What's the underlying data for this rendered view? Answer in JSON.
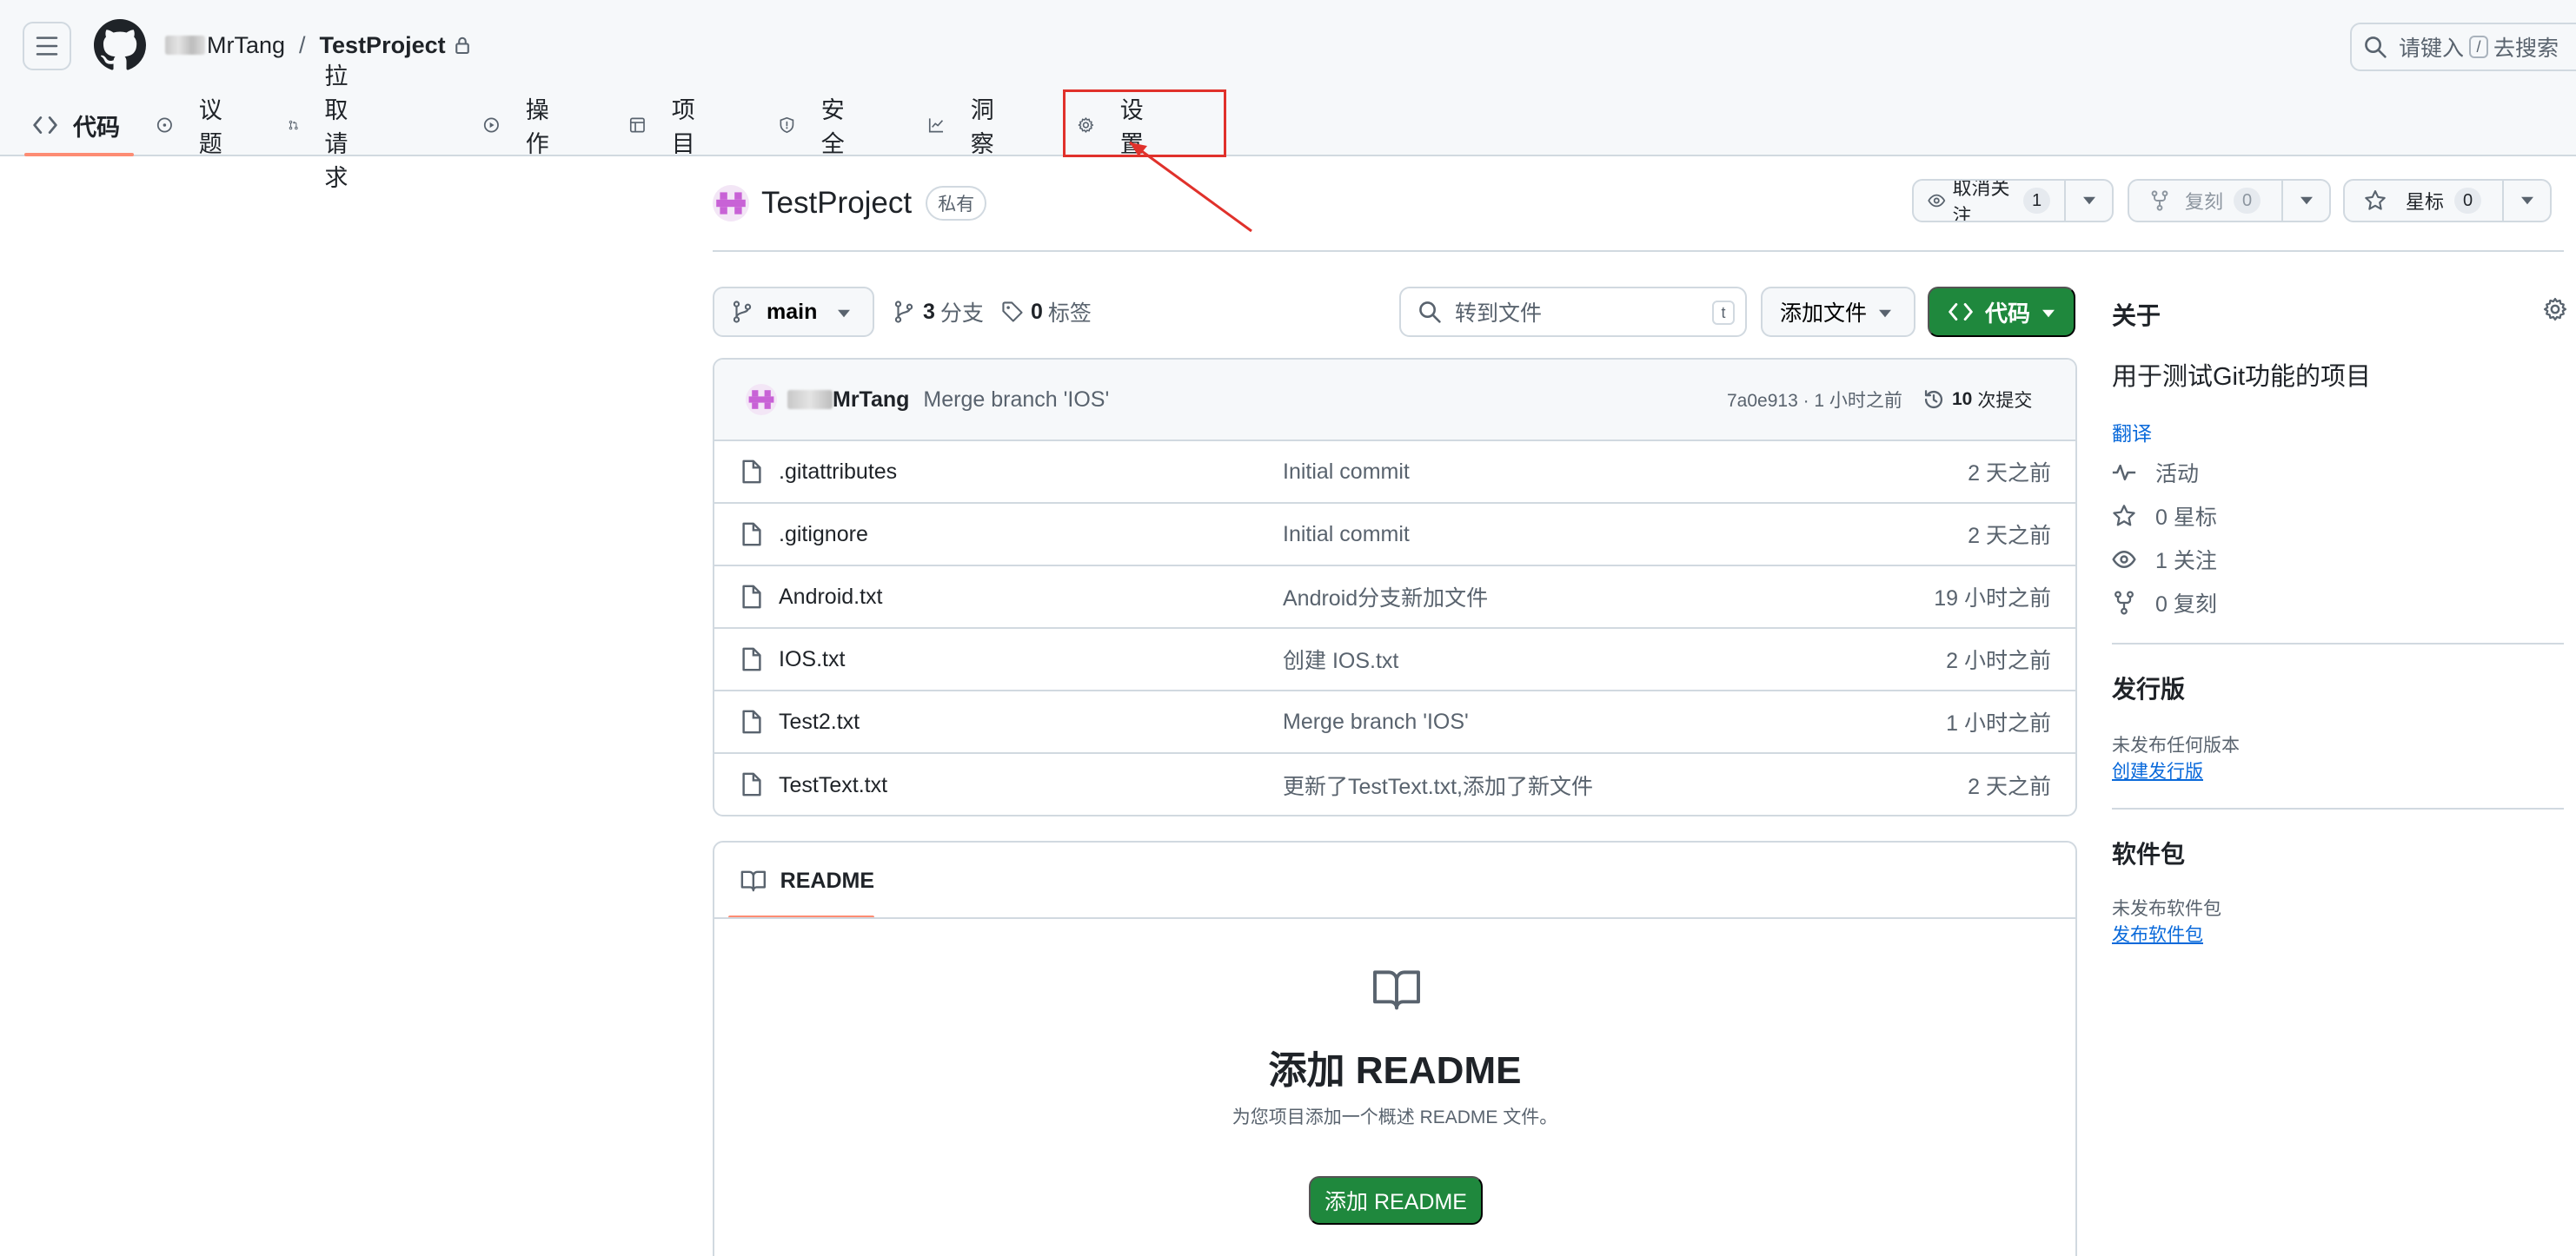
{
  "header": {
    "owner": "MrTang",
    "separator": "/",
    "repo": "TestProject",
    "search_placeholder_pre": "请键入",
    "search_slash": "/",
    "search_placeholder_post": "去搜索"
  },
  "tabs": [
    {
      "label": "代码",
      "icon": "code-icon",
      "active": true
    },
    {
      "label": "议题",
      "icon": "issue-opened-icon"
    },
    {
      "label": "拉取请求",
      "icon": "git-pull-request-icon"
    },
    {
      "label": "操作",
      "icon": "play-icon"
    },
    {
      "label": "项目",
      "icon": "table-icon"
    },
    {
      "label": "安全",
      "icon": "shield-icon"
    },
    {
      "label": "洞察",
      "icon": "graph-icon"
    },
    {
      "label": "设置",
      "icon": "gear-icon",
      "highlighted": true
    }
  ],
  "repo_title": {
    "name": "TestProject",
    "visibility": "私有"
  },
  "actions": {
    "watch_label": "取消关注",
    "watch_count": "1",
    "fork_label": "复刻",
    "fork_count": "0",
    "star_label": "星标",
    "star_count": "0"
  },
  "file_nav": {
    "branch": "main",
    "branches_count": "3",
    "branches_label": "分支",
    "tags_count": "0",
    "tags_label": "标签",
    "goto_placeholder": "转到文件",
    "goto_key": "t",
    "add_file_label": "添加文件",
    "code_label": "代码"
  },
  "latest_commit": {
    "author": "MrTang",
    "message": "Merge branch 'IOS'",
    "sha_and_age": "7a0e913 · 1 小时之前",
    "commits_count": "10",
    "commits_label": "次提交"
  },
  "files": [
    {
      "name": ".gitattributes",
      "message": "Initial commit",
      "age": "2 天之前"
    },
    {
      "name": ".gitignore",
      "message": "Initial commit",
      "age": "2 天之前"
    },
    {
      "name": "Android.txt",
      "message": "Android分支新加文件",
      "age": "19 小时之前"
    },
    {
      "name": "IOS.txt",
      "message": "创建 IOS.txt",
      "age": "2 小时之前"
    },
    {
      "name": "Test2.txt",
      "message": "Merge branch 'IOS'",
      "age": "1 小时之前"
    },
    {
      "name": "TestText.txt",
      "message": "更新了TestText.txt,添加了新文件",
      "age": "2 天之前"
    }
  ],
  "readme": {
    "tab_label": "README",
    "heading": "添加 README",
    "description": "为您项目添加一个概述 README 文件。",
    "button_label": "添加 README"
  },
  "sidebar": {
    "about_heading": "关于",
    "description": "用于测试Git功能的项目",
    "translate_link": "翻译",
    "stats": [
      {
        "label": "活动",
        "icon": "pulse-icon"
      },
      {
        "label": "0 星标",
        "icon": "star-icon"
      },
      {
        "label": "1 关注",
        "icon": "eye-icon"
      },
      {
        "label": "0 复刻",
        "icon": "repo-forked-icon"
      }
    ],
    "releases_heading": "发行版",
    "releases_note": "未发布任何版本",
    "releases_link": "创建发行版",
    "packages_heading": "软件包",
    "packages_note": "未发布软件包",
    "packages_link": "发布软件包"
  },
  "colors": {
    "primary_green": "#1f883d",
    "link_blue": "#0969da",
    "tab_underline": "#fd8c73",
    "annotation_red": "#e0312b",
    "border": "#d1d9e0"
  }
}
